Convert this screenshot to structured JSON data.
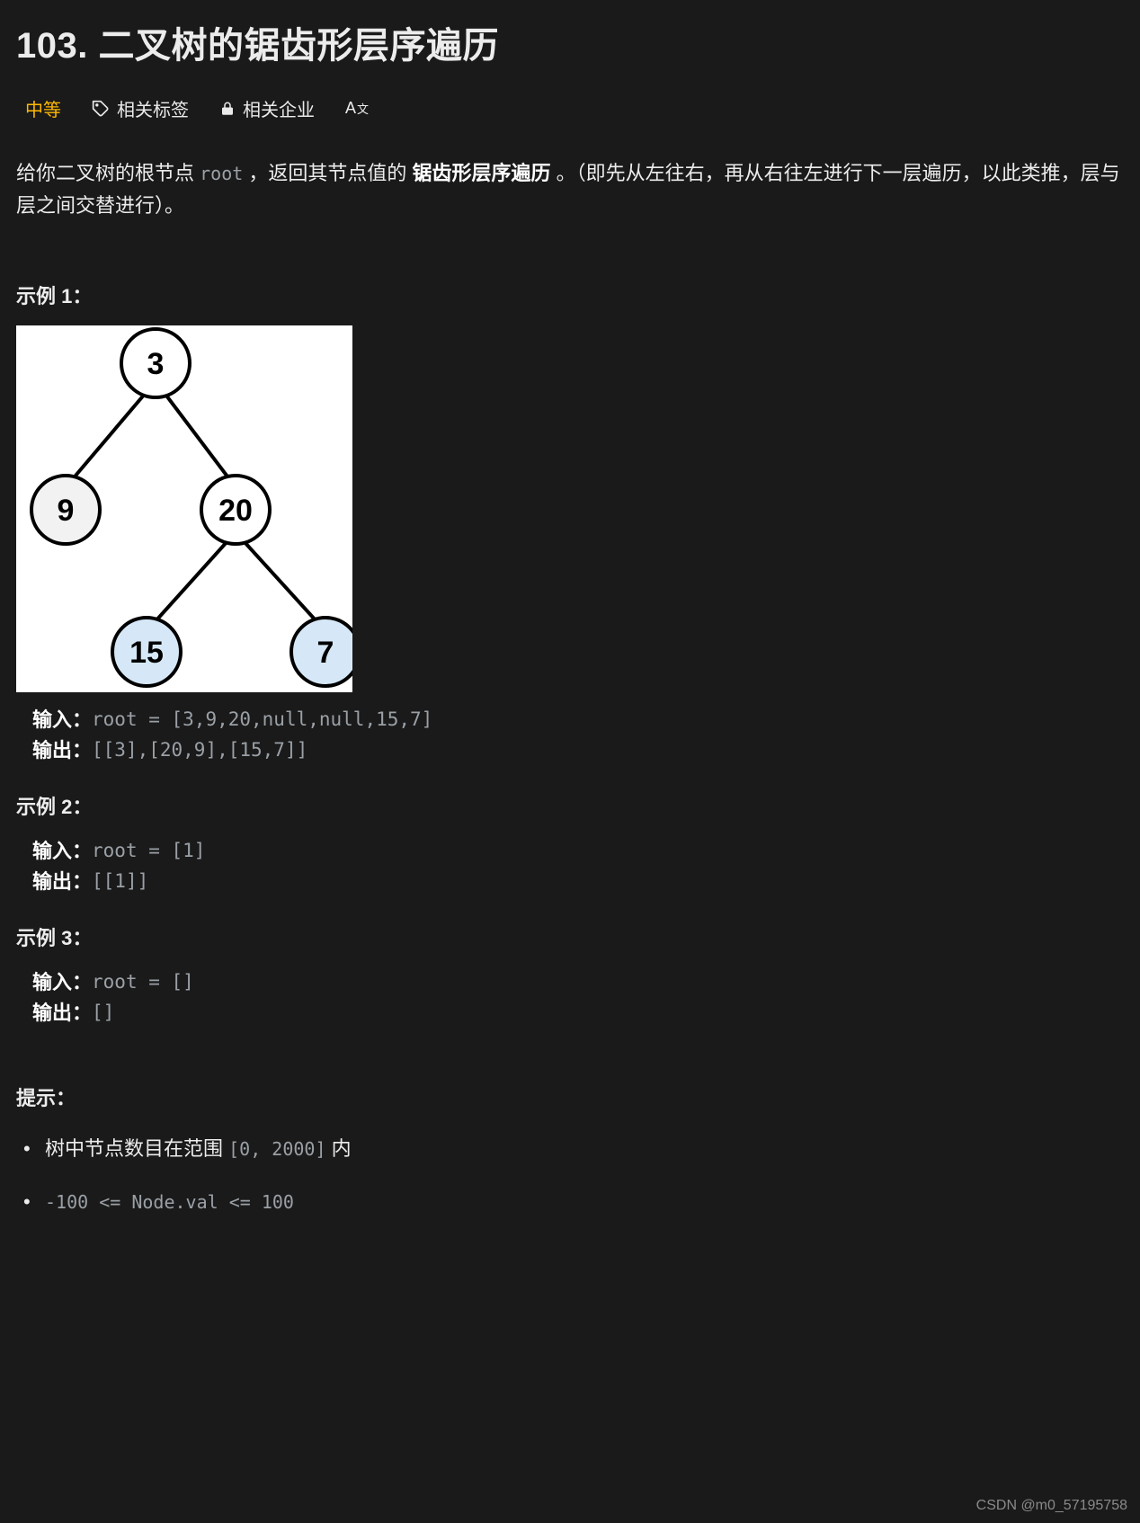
{
  "title": "103. 二叉树的锯齿形层序遍历",
  "meta": {
    "difficulty": "中等",
    "tags_label": "相关标签",
    "companies_label": "相关企业"
  },
  "description": {
    "pre": "给你二叉树的根节点 ",
    "root_code": "root",
    "mid": " ，返回其节点值的 ",
    "bold": "锯齿形层序遍历",
    "post": " 。（即先从左往右，再从右往左进行下一层遍历，以此类推，层与层之间交替进行）。"
  },
  "examples": [
    {
      "heading": "示例 1：",
      "has_figure": true,
      "tree": {
        "root": "3",
        "l": "9",
        "r": "20",
        "rl": "15",
        "rr": "7"
      },
      "input_label": "输入：",
      "input_value": "root = [3,9,20,null,null,15,7]",
      "output_label": "输出：",
      "output_value": "[[3],[20,9],[15,7]]"
    },
    {
      "heading": "示例 2：",
      "has_figure": false,
      "input_label": "输入：",
      "input_value": "root = [1]",
      "output_label": "输出：",
      "output_value": "[[1]]"
    },
    {
      "heading": "示例 3：",
      "has_figure": false,
      "input_label": "输入：",
      "input_value": "root = []",
      "output_label": "输出：",
      "output_value": "[]"
    }
  ],
  "hints": {
    "heading": "提示：",
    "items": [
      {
        "pre": "树中节点数目在范围 ",
        "code": "[0, 2000]",
        "post": " 内"
      },
      {
        "pre": "",
        "code": "-100 <= Node.val <= 100",
        "post": ""
      }
    ]
  },
  "watermark": "CSDN @m0_57195758"
}
